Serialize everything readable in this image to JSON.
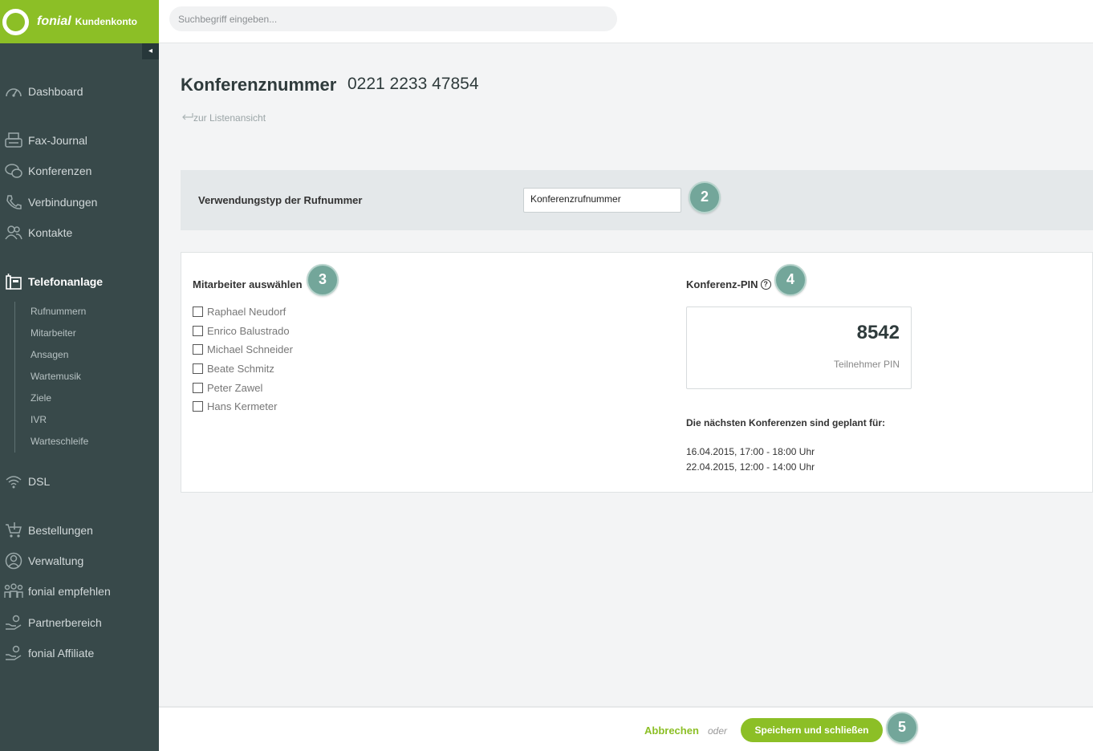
{
  "brand": {
    "name": "fonial",
    "subtitle": "Kundenkonto"
  },
  "search": {
    "placeholder": "Suchbegriff eingeben..."
  },
  "sidebar": {
    "collapse_glyph": "◂",
    "items": [
      {
        "label": "Dashboard",
        "icon": "speedometer-icon"
      },
      {
        "label": "Fax-Journal",
        "icon": "fax-icon"
      },
      {
        "label": "Konferenzen",
        "icon": "chat-bubbles-icon"
      },
      {
        "label": "Verbindungen",
        "icon": "phone-icon"
      },
      {
        "label": "Kontakte",
        "icon": "people-icon"
      },
      {
        "label": "Telefonanlage",
        "icon": "pbx-icon",
        "active": true
      },
      {
        "label": "DSL",
        "icon": "wifi-icon"
      },
      {
        "label": "Bestellungen",
        "icon": "cart-icon"
      },
      {
        "label": "Verwaltung",
        "icon": "user-circle-icon"
      },
      {
        "label": "fonial empfehlen",
        "icon": "group-icon"
      },
      {
        "label": "Partnerbereich",
        "icon": "hand-coin-icon"
      },
      {
        "label": "fonial Affiliate",
        "icon": "hand-coin-icon"
      }
    ],
    "subitems": [
      "Rufnummern",
      "Mitarbeiter",
      "Ansagen",
      "Wartemusik",
      "Ziele",
      "IVR",
      "Warteschleife"
    ]
  },
  "page": {
    "title": "Konferenznummer",
    "number": "0221 2233 47854",
    "back_link": "zur Listenansicht"
  },
  "usage": {
    "label": "Verwendungstyp der Rufnummer",
    "value": "Konferenzrufnummer"
  },
  "steps": [
    "2",
    "3",
    "4",
    "5"
  ],
  "staff": {
    "title": "Mitarbeiter auswählen",
    "members": [
      "Raphael Neudorf",
      "Enrico Balustrado",
      "Michael Schneider",
      "Beate Schmitz",
      "Peter Zawel",
      "Hans Kermeter"
    ]
  },
  "pin": {
    "title": "Konferenz-PIN",
    "value": "8542",
    "caption": "Teilnehmer PIN",
    "help_glyph": "?"
  },
  "conferences": {
    "title": "Die nächsten Konferenzen sind geplant für:",
    "items": [
      "16.04.2015, 17:00 - 18:00 Uhr",
      "22.04.2015, 12:00 - 14:00 Uhr"
    ]
  },
  "footer": {
    "cancel": "Abbrechen",
    "or": "oder",
    "save": "Speichern und schließen"
  },
  "colors": {
    "brand": "#8cbf26",
    "sidebar": "#38494a",
    "step": "#73a69a"
  }
}
